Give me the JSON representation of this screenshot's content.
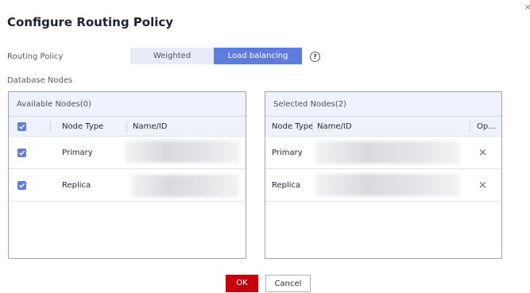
{
  "dialog": {
    "title": "Configure Routing Policy",
    "corner": "×"
  },
  "routing_policy": {
    "label": "Routing Policy",
    "options": [
      "Weighted",
      "Load balancing"
    ],
    "selected": "Load balancing",
    "help": "?"
  },
  "database_nodes": {
    "label": "Database Nodes"
  },
  "available": {
    "title": "Available Nodes(0)",
    "columns": {
      "node_type": "Node Type",
      "name_id": "Name/ID"
    },
    "rows": [
      {
        "node_type": "Primary",
        "checked": true
      },
      {
        "node_type": "Replica",
        "checked": true
      }
    ]
  },
  "selected": {
    "title": "Selected Nodes(2)",
    "columns": {
      "node_type": "Node Type",
      "name_id": "Name/ID",
      "op": "Op..."
    },
    "rows": [
      {
        "node_type": "Primary",
        "remove": "×"
      },
      {
        "node_type": "Replica",
        "remove": "×"
      }
    ]
  },
  "footer": {
    "ok": "OK",
    "cancel": "Cancel"
  },
  "colors": {
    "accent": "#5e7ce0",
    "primary_button": "#c7000b",
    "header_bg": "#eef2fb"
  },
  "icons": {
    "help": "help-circle-icon",
    "checkbox": "checkmark-icon",
    "remove": "close-icon"
  }
}
